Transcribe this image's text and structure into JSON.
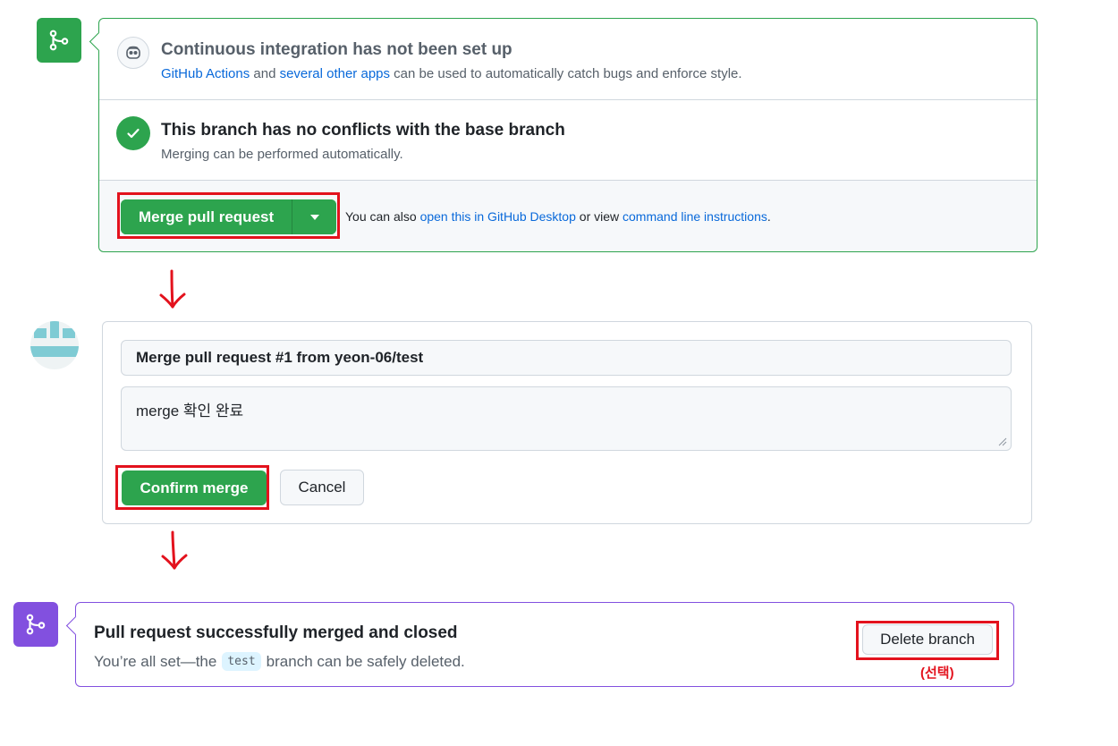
{
  "merge_section": {
    "ci_title": "Continuous integration has not been set up",
    "ci_link1": "GitHub Actions",
    "ci_and": " and ",
    "ci_link2": "several other apps",
    "ci_rest": " can be used to automatically catch bugs and enforce style.",
    "conflict_title": "This branch has no conflicts with the base branch",
    "conflict_sub": "Merging can be performed automatically.",
    "merge_button": "Merge pull request",
    "also_prefix": "You can also ",
    "also_link1": "open this in GitHub Desktop",
    "also_mid": " or view ",
    "also_link2": "command line instructions",
    "also_suffix": "."
  },
  "confirm_section": {
    "commit_title": "Merge pull request #1 from yeon-06/test",
    "commit_message": "merge 확인 완료",
    "confirm_button": "Confirm merge",
    "cancel_button": "Cancel"
  },
  "merged_section": {
    "title": "Pull request successfully merged and closed",
    "sub_prefix": "You’re all set—the",
    "branch_name": "test",
    "sub_suffix": "branch can be safely deleted.",
    "delete_button": "Delete branch",
    "annotation": "(선택)"
  },
  "icons": {
    "merge": "git-merge-icon",
    "ci": "copilot-robot-icon",
    "check": "check-icon",
    "dropdown": "triangle-down-icon",
    "arrow": "hand-drawn-down-arrow-icon",
    "merged": "git-merge-icon"
  },
  "colors": {
    "green": "#2da44e",
    "purple": "#8250df",
    "annotation_red": "#e3121d",
    "link": "#0969da"
  }
}
